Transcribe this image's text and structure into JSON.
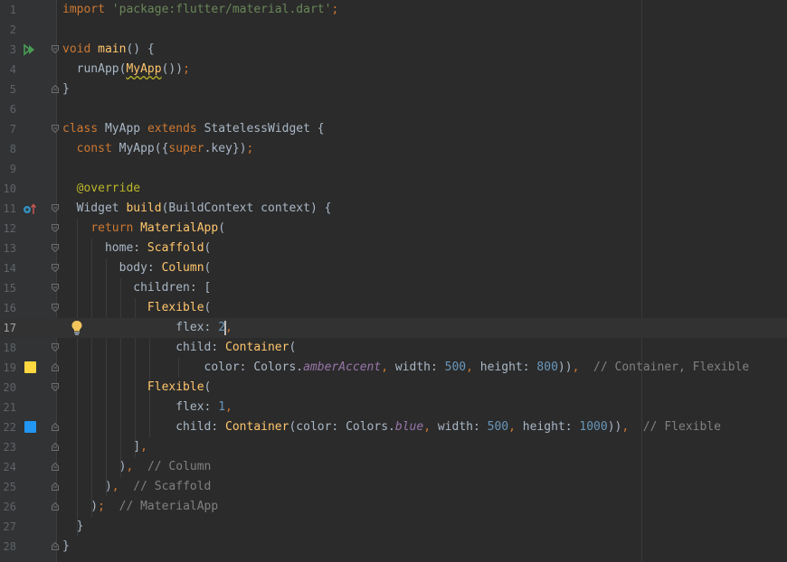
{
  "colors": {
    "amber_swatch": "#ffd740",
    "blue_swatch": "#2196f3",
    "run_icon": "#499c54",
    "bulb_icon": "#f2c55c"
  },
  "icons": [
    "run-gutter-icon",
    "override-gutter-icon",
    "intention-bulb-icon",
    "color-swatch-icon",
    "fold-marker-icon"
  ],
  "editor": {
    "current_line": 17,
    "line_numbers": [
      "1",
      "2",
      "3",
      "4",
      "5",
      "6",
      "7",
      "8",
      "9",
      "10",
      "11",
      "12",
      "13",
      "14",
      "15",
      "16",
      "17",
      "18",
      "19",
      "20",
      "21",
      "22",
      "23",
      "24",
      "25",
      "26",
      "27",
      "28"
    ],
    "lines": [
      [
        {
          "t": "import ",
          "c": "kw"
        },
        {
          "t": "'package:flutter/material.dart'",
          "c": "str"
        },
        {
          "t": ";",
          "c": "pu"
        }
      ],
      [],
      [
        {
          "t": "void ",
          "c": "kw"
        },
        {
          "t": "main",
          "c": "fn"
        },
        {
          "t": "() {",
          "c": ""
        }
      ],
      [
        {
          "t": "  runApp(",
          "c": ""
        },
        {
          "t": "MyApp",
          "c": "fn squig"
        },
        {
          "t": "())",
          "c": ""
        },
        {
          "t": ";",
          "c": "pu"
        }
      ],
      [
        {
          "t": "}",
          "c": ""
        }
      ],
      [],
      [
        {
          "t": "class ",
          "c": "kw"
        },
        {
          "t": "MyApp ",
          "c": ""
        },
        {
          "t": "extends ",
          "c": "kw"
        },
        {
          "t": "StatelessWidget {",
          "c": ""
        }
      ],
      [
        {
          "t": "  ",
          "c": ""
        },
        {
          "t": "const ",
          "c": "kw"
        },
        {
          "t": "MyApp({",
          "c": ""
        },
        {
          "t": "super",
          "c": "kw"
        },
        {
          "t": ".key})",
          "c": ""
        },
        {
          "t": ";",
          "c": "pu"
        }
      ],
      [],
      [
        {
          "t": "  ",
          "c": ""
        },
        {
          "t": "@override",
          "c": "ann"
        }
      ],
      [
        {
          "t": "  Widget ",
          "c": ""
        },
        {
          "t": "build",
          "c": "fn"
        },
        {
          "t": "(BuildContext context) {",
          "c": ""
        }
      ],
      [
        {
          "t": "    ",
          "c": ""
        },
        {
          "t": "return ",
          "c": "kw"
        },
        {
          "t": "MaterialApp",
          "c": "fn"
        },
        {
          "t": "(",
          "c": ""
        }
      ],
      [
        {
          "t": "      home: ",
          "c": ""
        },
        {
          "t": "Scaffold",
          "c": "fn"
        },
        {
          "t": "(",
          "c": ""
        }
      ],
      [
        {
          "t": "        body: ",
          "c": ""
        },
        {
          "t": "Column",
          "c": "fn"
        },
        {
          "t": "(",
          "c": ""
        }
      ],
      [
        {
          "t": "          children: [",
          "c": ""
        }
      ],
      [
        {
          "t": "            ",
          "c": ""
        },
        {
          "t": "Flexible",
          "c": "fn"
        },
        {
          "t": "(",
          "c": ""
        }
      ],
      [
        {
          "t": "                flex: ",
          "c": ""
        },
        {
          "t": "2",
          "c": "num"
        },
        {
          "t": "",
          "c": "caret"
        },
        {
          "t": ",",
          "c": "pu"
        }
      ],
      [
        {
          "t": "                child: ",
          "c": ""
        },
        {
          "t": "Container",
          "c": "fn"
        },
        {
          "t": "(",
          "c": ""
        }
      ],
      [
        {
          "t": "                    color: Colors.",
          "c": ""
        },
        {
          "t": "amberAccent",
          "c": "prop"
        },
        {
          "t": ", ",
          "c": "pu"
        },
        {
          "t": "width: ",
          "c": ""
        },
        {
          "t": "500",
          "c": "num"
        },
        {
          "t": ", ",
          "c": "pu"
        },
        {
          "t": "height: ",
          "c": ""
        },
        {
          "t": "800",
          "c": "num"
        },
        {
          "t": "))",
          "c": ""
        },
        {
          "t": ",  ",
          "c": "pu"
        },
        {
          "t": "// Container, Flexible",
          "c": "cmt"
        }
      ],
      [
        {
          "t": "            ",
          "c": ""
        },
        {
          "t": "Flexible",
          "c": "fn"
        },
        {
          "t": "(",
          "c": ""
        }
      ],
      [
        {
          "t": "                flex: ",
          "c": ""
        },
        {
          "t": "1",
          "c": "num"
        },
        {
          "t": ",",
          "c": "pu"
        }
      ],
      [
        {
          "t": "                child: ",
          "c": ""
        },
        {
          "t": "Container",
          "c": "fn"
        },
        {
          "t": "(color: Colors.",
          "c": ""
        },
        {
          "t": "blue",
          "c": "prop"
        },
        {
          "t": ", ",
          "c": "pu"
        },
        {
          "t": "width: ",
          "c": ""
        },
        {
          "t": "500",
          "c": "num"
        },
        {
          "t": ", ",
          "c": "pu"
        },
        {
          "t": "height: ",
          "c": ""
        },
        {
          "t": "1000",
          "c": "num"
        },
        {
          "t": "))",
          "c": ""
        },
        {
          "t": ",  ",
          "c": "pu"
        },
        {
          "t": "// Flexible",
          "c": "cmt"
        }
      ],
      [
        {
          "t": "          ]",
          "c": ""
        },
        {
          "t": ",",
          "c": "pu"
        }
      ],
      [
        {
          "t": "        )",
          "c": ""
        },
        {
          "t": ",  ",
          "c": "pu"
        },
        {
          "t": "// Column",
          "c": "cmt"
        }
      ],
      [
        {
          "t": "      )",
          "c": ""
        },
        {
          "t": ",  ",
          "c": "pu"
        },
        {
          "t": "// Scaffold",
          "c": "cmt"
        }
      ],
      [
        {
          "t": "    )",
          "c": ""
        },
        {
          "t": ";  ",
          "c": "pu"
        },
        {
          "t": "// MaterialApp",
          "c": "cmt"
        }
      ],
      [
        {
          "t": "  }",
          "c": ""
        }
      ],
      [
        {
          "t": "}",
          "c": ""
        }
      ]
    ]
  }
}
